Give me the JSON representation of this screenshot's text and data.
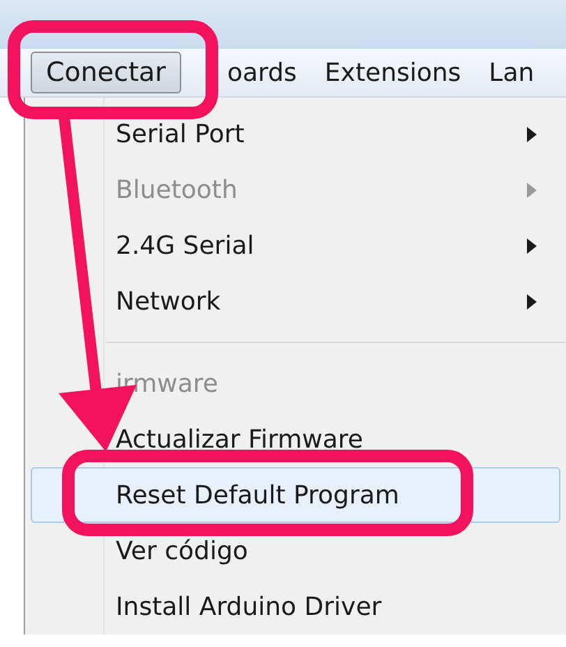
{
  "menubar": [
    {
      "label": "Conectar",
      "selected": true
    },
    {
      "label": "oards",
      "selected": false
    },
    {
      "label": "Extensions",
      "selected": false
    },
    {
      "label": "Lan",
      "selected": false
    }
  ],
  "menu": [
    {
      "kind": "item",
      "label": "Serial Port",
      "disabled": false,
      "submenu": true,
      "highlighted": false
    },
    {
      "kind": "item",
      "label": "Bluetooth",
      "disabled": true,
      "submenu": true,
      "highlighted": false
    },
    {
      "kind": "item",
      "label": "2.4G Serial",
      "disabled": false,
      "submenu": true,
      "highlighted": false
    },
    {
      "kind": "item",
      "label": "Network",
      "disabled": false,
      "submenu": true,
      "highlighted": false
    },
    {
      "kind": "separator"
    },
    {
      "kind": "item",
      "label": "irmware",
      "disabled": true,
      "submenu": false,
      "highlighted": false
    },
    {
      "kind": "item",
      "label": "Actualizar Firmware",
      "disabled": false,
      "submenu": false,
      "highlighted": false
    },
    {
      "kind": "item",
      "label": "Reset Default Program",
      "disabled": false,
      "submenu": false,
      "highlighted": true
    },
    {
      "kind": "item",
      "label": "Ver código",
      "disabled": false,
      "submenu": false,
      "highlighted": false
    },
    {
      "kind": "item",
      "label": "Install Arduino Driver",
      "disabled": false,
      "submenu": false,
      "highlighted": false
    }
  ]
}
